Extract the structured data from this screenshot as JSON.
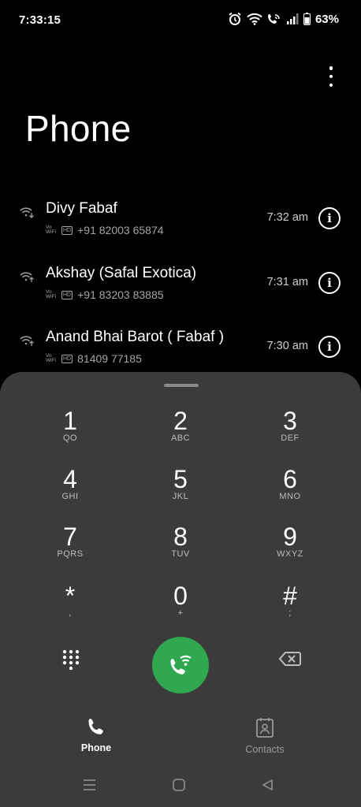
{
  "status_bar": {
    "time": "7:33:15",
    "battery": "63%",
    "icons": [
      "alarm-icon",
      "wifi-icon",
      "wifi-calling-icon",
      "signal-icon",
      "battery-icon"
    ]
  },
  "header": {
    "title": "Phone",
    "more_icon": "more-vertical-icon"
  },
  "recents": [
    {
      "name": "Divy Fabaf",
      "number": "+91 82003 65874",
      "time": "7:32 am",
      "type": "incoming-wifi-call"
    },
    {
      "name": "Akshay (Safal Exotica)",
      "number": "+91 83203 83885",
      "time": "7:31 am",
      "type": "outgoing-wifi-call"
    },
    {
      "name": "Anand Bhai Barot ( Fabaf )",
      "number": "81409 77185",
      "time": "7:30 am",
      "type": "outgoing-wifi-call"
    }
  ],
  "badges": {
    "vowifi_top": "Vo",
    "vowifi_bottom": "WiFi",
    "hd": "HD"
  },
  "dialpad": {
    "keys": [
      {
        "digit": "1",
        "letters": "QO"
      },
      {
        "digit": "2",
        "letters": "ABC"
      },
      {
        "digit": "3",
        "letters": "DEF"
      },
      {
        "digit": "4",
        "letters": "GHI"
      },
      {
        "digit": "5",
        "letters": "JKL"
      },
      {
        "digit": "6",
        "letters": "MNO"
      },
      {
        "digit": "7",
        "letters": "PQRS"
      },
      {
        "digit": "8",
        "letters": "TUV"
      },
      {
        "digit": "9",
        "letters": "WXYZ"
      },
      {
        "digit": "*",
        "letters": ","
      },
      {
        "digit": "0",
        "letters": "+"
      },
      {
        "digit": "#",
        "letters": ";"
      }
    ],
    "call_color": "#2fa84f"
  },
  "bottom_tabs": [
    {
      "label": "Phone",
      "icon": "phone-icon",
      "active": true
    },
    {
      "label": "Contacts",
      "icon": "contacts-icon",
      "active": false
    }
  ],
  "navbar": [
    "recents-nav-icon",
    "home-nav-icon",
    "back-nav-icon"
  ]
}
